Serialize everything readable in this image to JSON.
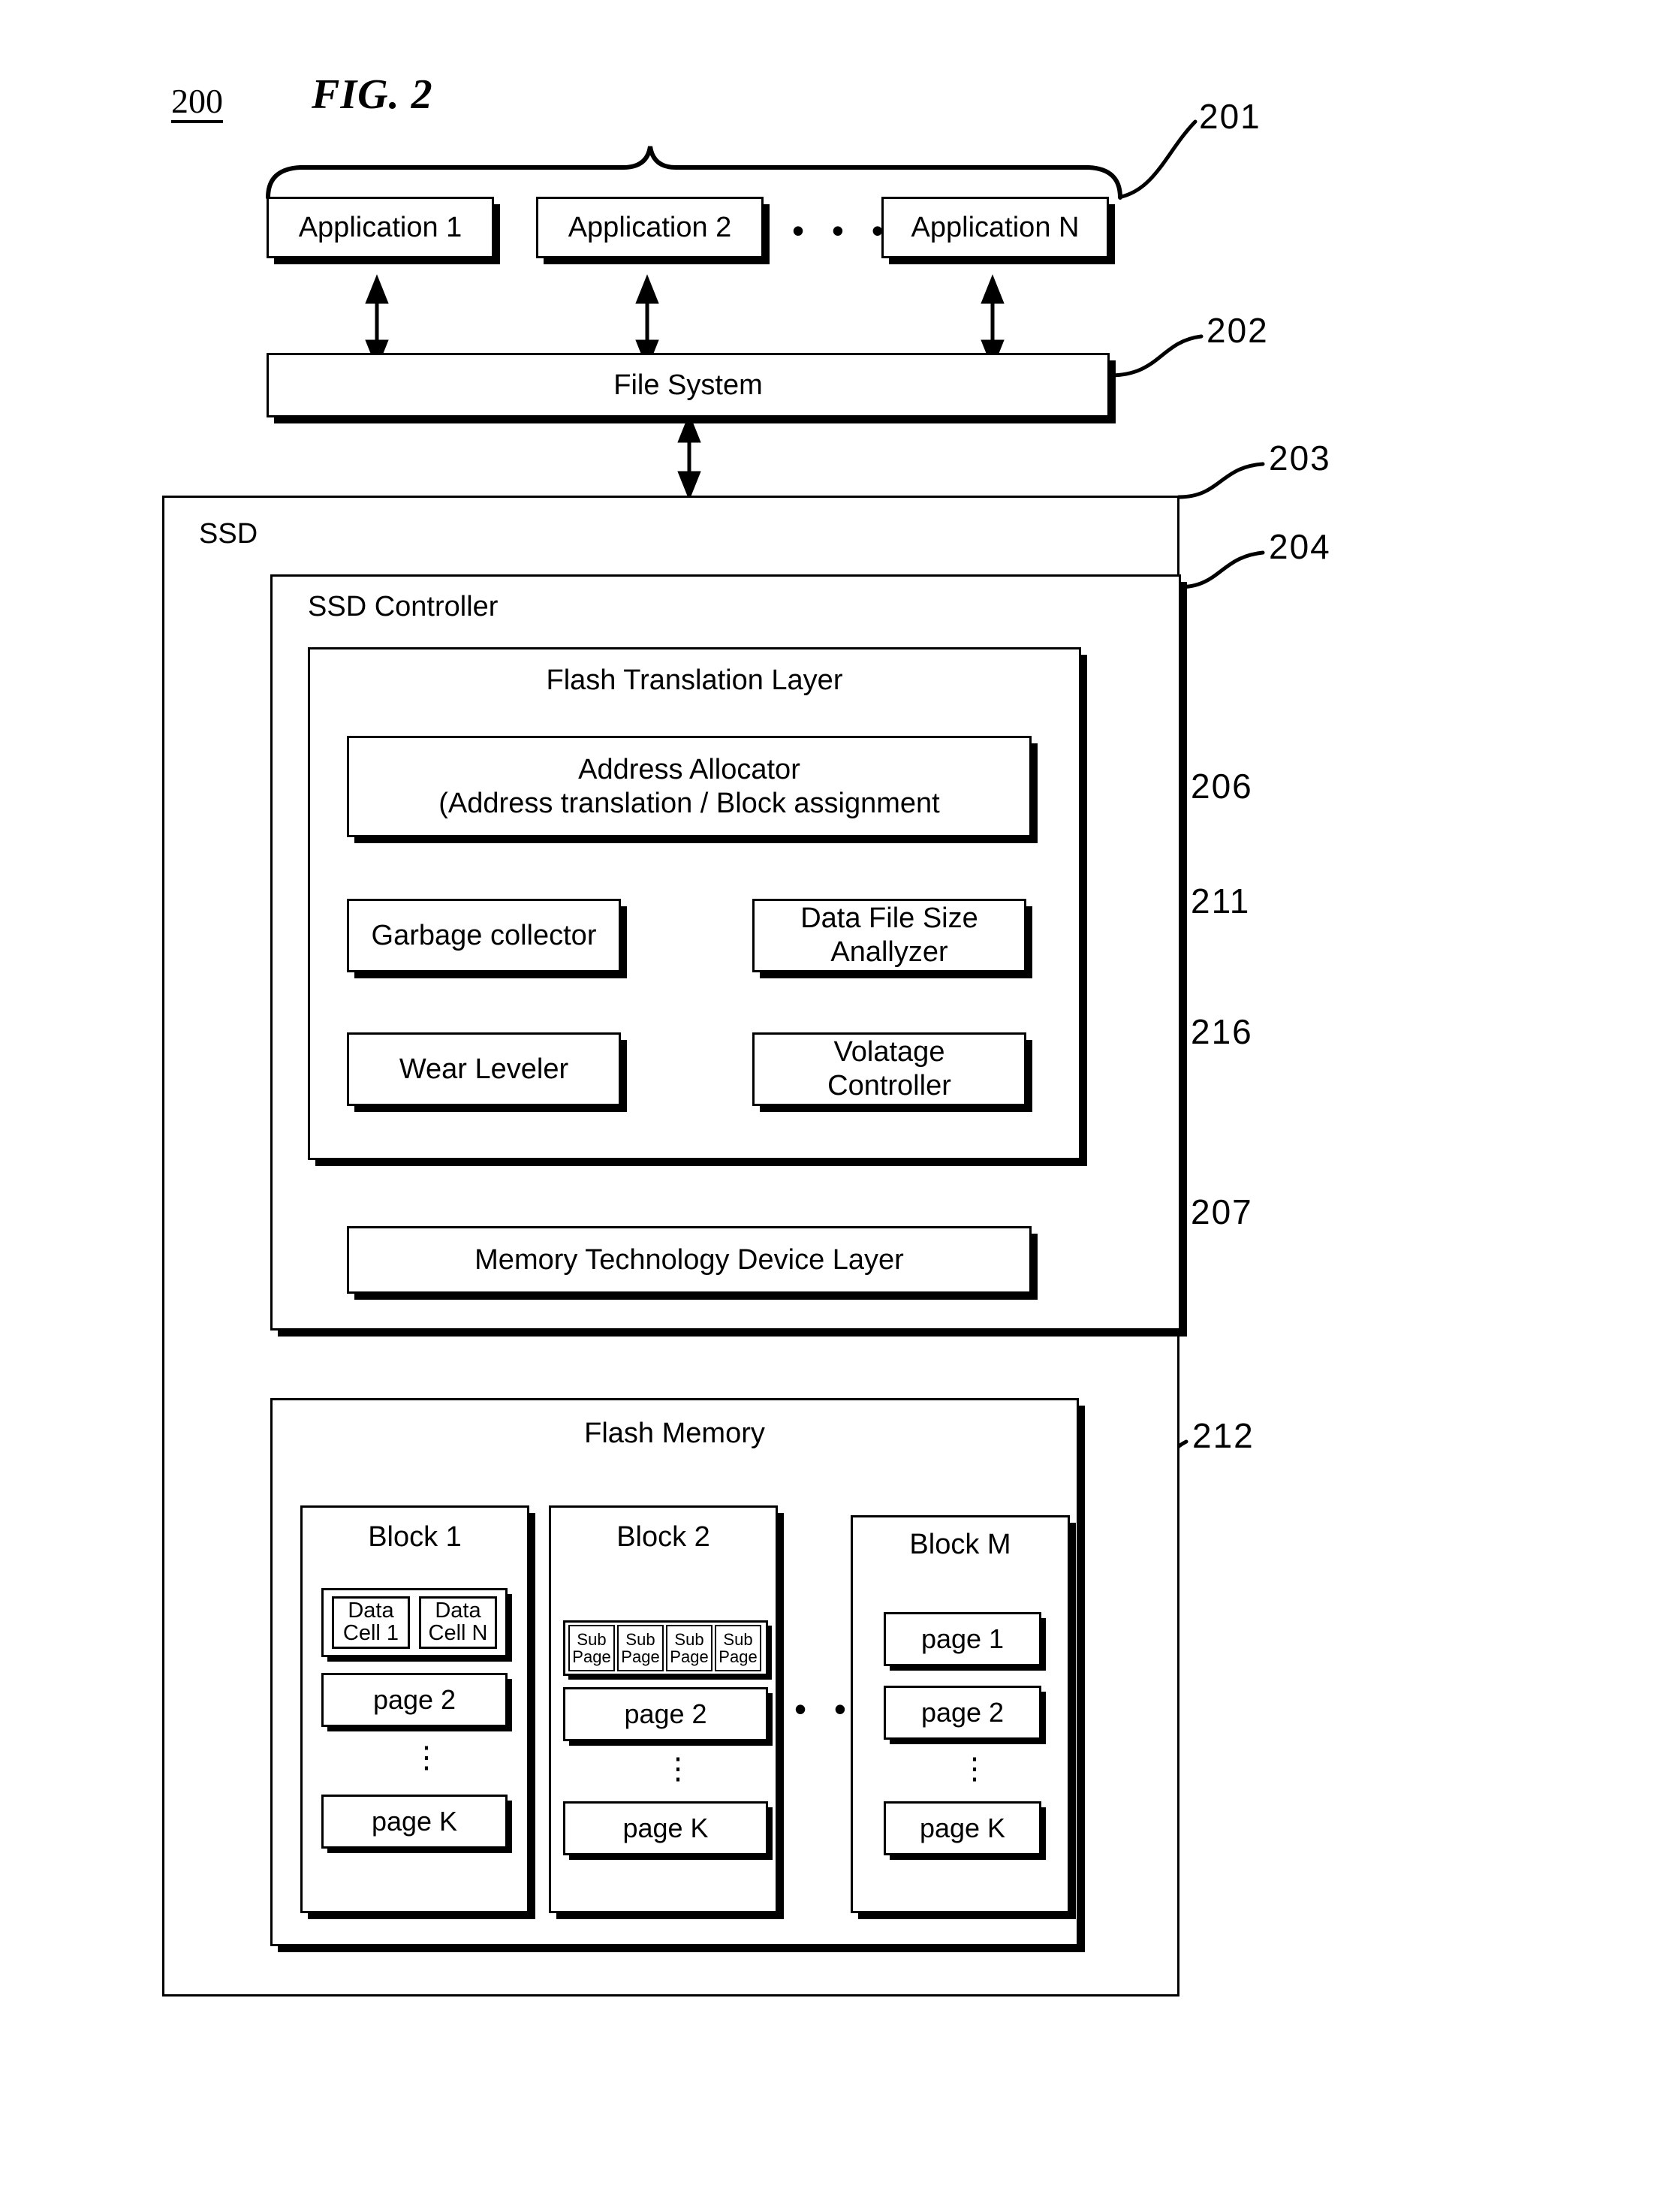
{
  "figure": {
    "number": "200",
    "title": "FIG. 2"
  },
  "reference_numerals": [
    {
      "id": "201",
      "target": "applications-group"
    },
    {
      "id": "202",
      "target": "file-system"
    },
    {
      "id": "203",
      "target": "ssd"
    },
    {
      "id": "204",
      "target": "ssd-controller"
    },
    {
      "id": "206",
      "target": "flash-translation-layer"
    },
    {
      "id": "211",
      "target": "data-file-size-anallyzer"
    },
    {
      "id": "216",
      "target": "volatage-controller"
    },
    {
      "id": "207",
      "target": "memory-technology-device-layer"
    },
    {
      "id": "212",
      "target": "flash-memory"
    }
  ],
  "applications": {
    "items": [
      {
        "label": "Application 1"
      },
      {
        "label": "Application 2"
      },
      {
        "label": "Application N"
      }
    ],
    "ellipsis": "• • •"
  },
  "file_system": {
    "label": "File System"
  },
  "ssd": {
    "label": "SSD",
    "controller": {
      "label": "SSD Controller",
      "ftl": {
        "label": "Flash Translation Layer",
        "address_allocator": {
          "line1": "Address Allocator",
          "line2": "(Address translation / Block assignment"
        },
        "modules": [
          {
            "line1": "Garbage collector",
            "line2": ""
          },
          {
            "line1": "Data File Size",
            "line2": "Anallyzer"
          },
          {
            "line1": "Wear Leveler",
            "line2": ""
          },
          {
            "line1": "Volatage",
            "line2": "Controller"
          }
        ]
      },
      "mtd": {
        "label": "Memory Technology Device Layer"
      }
    },
    "flash_memory": {
      "label": "Flash Memory",
      "ellipsis": "• • •",
      "vertical_ellipsis": "⋮",
      "blocks": [
        {
          "title": "Block 1",
          "first_row_type": "data-cells",
          "data_cells": [
            "Data\nCell 1",
            "Data\nCell N"
          ],
          "sub_pages": [],
          "pages": [
            "page 2",
            "page K"
          ]
        },
        {
          "title": "Block 2",
          "first_row_type": "sub-pages",
          "data_cells": [],
          "sub_pages": [
            "Sub\nPage",
            "Sub\nPage",
            "Sub\nPage",
            "Sub\nPage"
          ],
          "pages": [
            "page 2",
            "page K"
          ]
        },
        {
          "title": "Block M",
          "first_row_type": "page",
          "data_cells": [],
          "sub_pages": [],
          "pages": [
            "page 1",
            "page 2",
            "page K"
          ]
        }
      ]
    }
  },
  "colors": {
    "ink": "#000000",
    "paper": "#ffffff"
  }
}
